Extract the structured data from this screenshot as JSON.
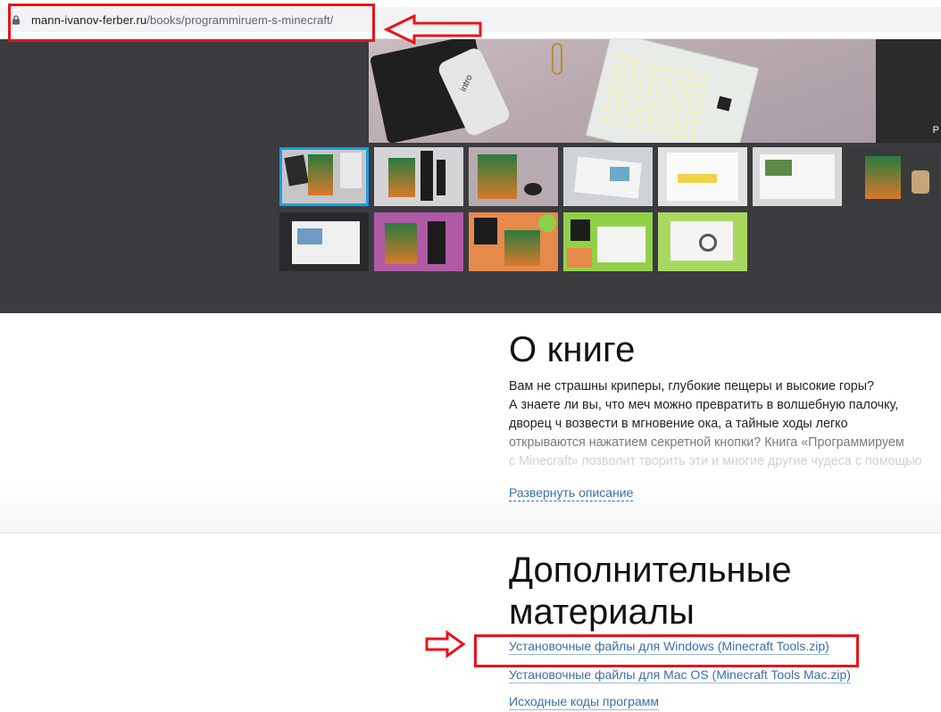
{
  "browser": {
    "url_host": "mann-ivanov-ferber.ru",
    "url_path": "/books/programmiruem-s-minecraft/"
  },
  "gallery": {
    "main_photo_brand": "intro",
    "main_photo_corner": "P",
    "thumbnail_count": 12,
    "selected_thumbnail": 1
  },
  "about": {
    "heading": "О книге",
    "lines": [
      "Вам не страшны криперы, глубокие пещеры и высокие горы?",
      "А знаете ли вы, что меч можно превратить в волшебную палочку,",
      "дворец ч возвести в мгновение ока, а тайные ходы легко",
      "открываются нажатием секретной кнопки? Книга «Программируем",
      "с Minecraft» позволит творить эти и многие другие чудеса с помощью"
    ],
    "expand_label": "Развернуть описание"
  },
  "materials": {
    "heading_line1": "Дополнительные",
    "heading_line2": "материалы",
    "links": [
      "Установочные файлы для Windows (Minecraft Tools.zip)",
      "Установочные файлы для Mac OS (Minecraft Tools Mac.zip)",
      "Исходные коды программ"
    ]
  },
  "annotations": {
    "color": "#e8141c"
  }
}
